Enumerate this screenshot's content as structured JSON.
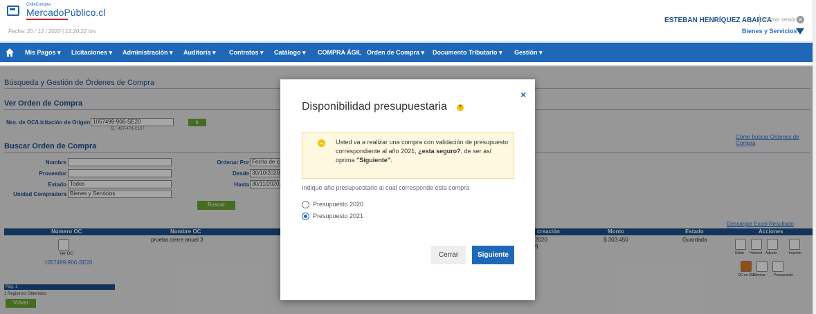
{
  "header": {
    "logo_small": "ChileCompra",
    "logo_main": "MercadoPúblico.cl",
    "fecha": "Fecha: 20 / 12 / 2020 | 12:20:22 hrs",
    "user": "ESTEBAN HENRÍQUEZ ABARCA",
    "logout": "Cerrar sesión",
    "logout_glyph": "✕",
    "org": "Bienes y Servicios"
  },
  "nav": {
    "items": [
      "Mis Pagos ▾",
      "Licitaciones ▾",
      "Administración ▾",
      "Auditoría ▾",
      "Contratos ▾",
      "Catálogo ▾",
      "COMPRA ÁGIL",
      "Orden de Compra ▾",
      "Documento Tributario ▾",
      "Gestión ▾"
    ]
  },
  "page": {
    "title": "Búsqueda y Gestión de Órdenes de Compra",
    "ver_oc": "Ver Orden de Compra",
    "nro_label": "Nro. de OC/Licitación de Origen",
    "nro_value": "1057499-906-SE20",
    "nro_hint": "Ej.: 497-479-C107",
    "ir_btn": "Ir",
    "buscar_oc": "Buscar Orden de Compra",
    "help_link": "Cómo buscar Ordenes de Compra",
    "nombre_label": "Nombre",
    "proveedor_label": "Proveedor",
    "estado_label": "Estado",
    "estado_value": "Todos",
    "unidad_label": "Unidad Compradora",
    "unidad_value": "Bienes y Servicios",
    "ordenar_label": "Ordenar Por",
    "ordenar_value": "Fecha de c",
    "desde_label": "Desde",
    "desde_value": "30/10/2020",
    "hasta_label": "Hasta",
    "hasta_value": "30/11/2020",
    "buscar_btn": "Buscar",
    "excel_link": "Descargar Excel Resultado Búsqueda",
    "table_headers": [
      "Número OC",
      "Nombre OC",
      "creación",
      "Monto",
      "Estado",
      "Acciones"
    ],
    "row": {
      "ver_oc": "Ver OC",
      "numero": "1057499-906-SE20",
      "nombre": "prueba cierre anual 3",
      "fecha": "2020",
      "fecha_cont": "9",
      "monto": "$ 303.450",
      "estado": "Guardada"
    },
    "acciones": [
      "Editar",
      "Historial",
      "Adjunto",
      "Imprimir",
      "OC en XML",
      "Eliminar",
      "Presupuesto"
    ],
    "pag": "Pág. 1",
    "registros": "1 Registro/s Obtenidos",
    "volver_btn": "Volver"
  },
  "modal": {
    "title": "Disponibilidad presupuestaria",
    "help_glyph": "?",
    "close_glyph": "×",
    "warning_part1": "Usted va a realizar una compra con validación de presupuesto correspondiente al año 2021, ",
    "warning_bold": "¿esta seguro?",
    "warning_part2": ", de ser así oprima ",
    "warning_bold2": "\"Siguiente\"",
    "warning_end": ".",
    "question": "Indique año presupuestario al cual corresponde ésta compra",
    "options": [
      {
        "label": "Presupuesto 2020",
        "selected": false
      },
      {
        "label": "Presupuesto 2021",
        "selected": true
      }
    ],
    "cerrar": "Cerrar",
    "siguiente": "Siguiente"
  },
  "colors": {
    "nav_blue": "#1f68b8",
    "dark_blue": "#1d4f8c",
    "green": "#6aa834",
    "warn_bg": "#fff8e1"
  }
}
